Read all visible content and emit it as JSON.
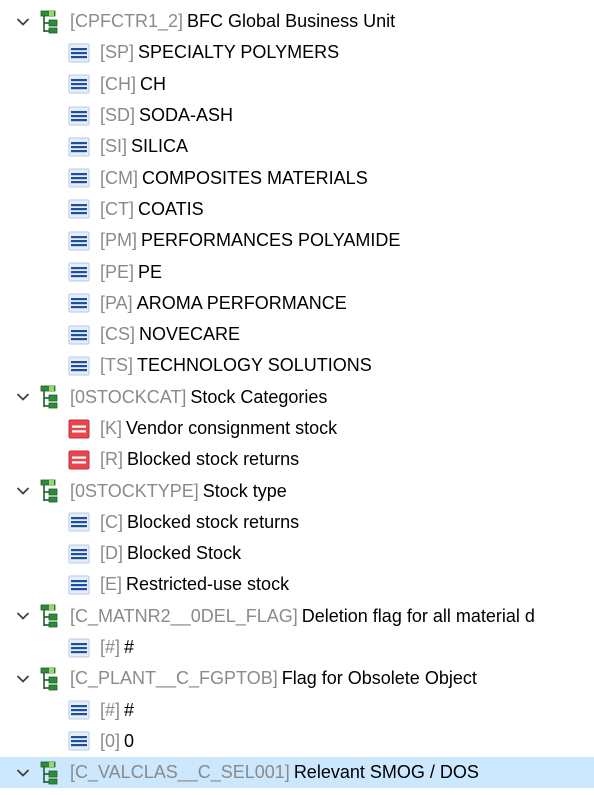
{
  "tree": [
    {
      "code": "[CPFCTR1_2]",
      "label": "BFC Global Business Unit",
      "children": [
        {
          "code": "[SP]",
          "label": "SPECIALTY POLYMERS",
          "icon": "blue"
        },
        {
          "code": "[CH]",
          "label": "CH",
          "icon": "blue"
        },
        {
          "code": "[SD]",
          "label": "SODA-ASH",
          "icon": "blue"
        },
        {
          "code": "[SI]",
          "label": "SILICA",
          "icon": "blue"
        },
        {
          "code": "[CM]",
          "label": "COMPOSITES MATERIALS",
          "icon": "blue"
        },
        {
          "code": "[CT]",
          "label": "COATIS",
          "icon": "blue"
        },
        {
          "code": "[PM]",
          "label": "PERFORMANCES POLYAMIDE",
          "icon": "blue"
        },
        {
          "code": "[PE]",
          "label": "PE",
          "icon": "blue"
        },
        {
          "code": "[PA]",
          "label": "AROMA PERFORMANCE",
          "icon": "blue"
        },
        {
          "code": "[CS]",
          "label": "NOVECARE",
          "icon": "blue"
        },
        {
          "code": "[TS]",
          "label": "TECHNOLOGY SOLUTIONS",
          "icon": "blue"
        }
      ]
    },
    {
      "code": "[0STOCKCAT]",
      "label": "Stock Categories",
      "children": [
        {
          "code": "[K]",
          "label": "Vendor consignment stock",
          "icon": "red"
        },
        {
          "code": "[R]",
          "label": "Blocked stock returns",
          "icon": "red"
        }
      ]
    },
    {
      "code": "[0STOCKTYPE]",
      "label": "Stock type",
      "children": [
        {
          "code": "[C]",
          "label": "Blocked stock returns",
          "icon": "blue"
        },
        {
          "code": "[D]",
          "label": "Blocked Stock",
          "icon": "blue"
        },
        {
          "code": "[E]",
          "label": "Restricted-use stock",
          "icon": "blue"
        }
      ]
    },
    {
      "code": "[C_MATNR2__0DEL_FLAG]",
      "label": "Deletion flag for all material d",
      "children": [
        {
          "code": "[#]",
          "label": "#",
          "icon": "blue"
        }
      ]
    },
    {
      "code": "[C_PLANT__C_FGPTOB]",
      "label": "Flag for Obsolete Object",
      "children": [
        {
          "code": "[#]",
          "label": "#",
          "icon": "blue"
        },
        {
          "code": "[0]",
          "label": "0",
          "icon": "blue"
        }
      ]
    },
    {
      "code": "[C_VALCLAS__C_SEL001]",
      "label": "Relevant SMOG / DOS",
      "selected": true,
      "children": []
    }
  ],
  "colors": {
    "selection": "#cce8ff",
    "code_text": "#8a8a8a",
    "blue_icon_bg": "#e6eefb",
    "blue_icon_bar": "#1f4f99",
    "red_icon_bg": "#e8474f",
    "red_icon_bar": "#ffffff"
  }
}
